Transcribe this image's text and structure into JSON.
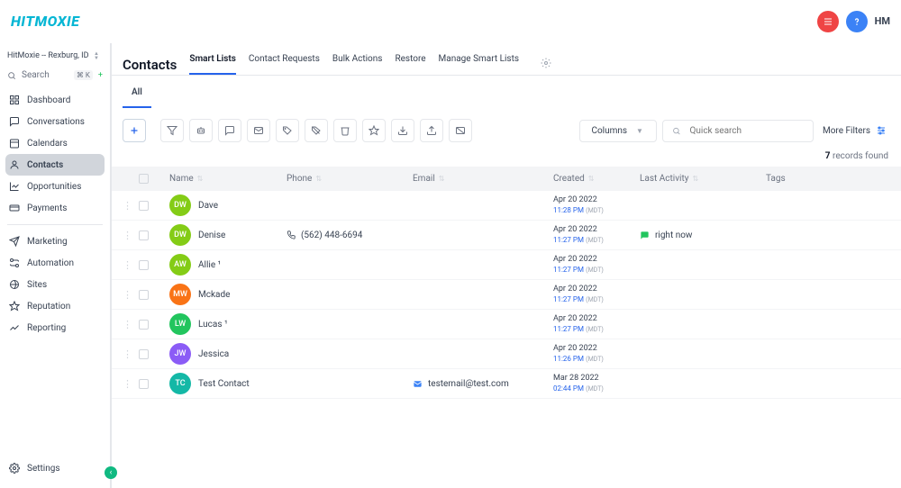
{
  "topbar": {
    "logo": "HITMOXIE",
    "hm": "HM"
  },
  "account": {
    "name": "HitMoxie -- Rexburg, ID"
  },
  "search": {
    "placeholder": "Search",
    "kbd": "⌘ K"
  },
  "nav": {
    "dashboard": "Dashboard",
    "conversations": "Conversations",
    "calendars": "Calendars",
    "contacts": "Contacts",
    "opportunities": "Opportunities",
    "payments": "Payments",
    "marketing": "Marketing",
    "automation": "Automation",
    "sites": "Sites",
    "reputation": "Reputation",
    "reporting": "Reporting",
    "settings": "Settings"
  },
  "page": {
    "title": "Contacts"
  },
  "tabs": {
    "smartlists": "Smart Lists",
    "requests": "Contact Requests",
    "bulk": "Bulk Actions",
    "restore": "Restore",
    "manage": "Manage Smart Lists"
  },
  "subtabs": {
    "all": "All"
  },
  "toolbar": {
    "columns": "Columns",
    "quicksearch_placeholder": "Quick search",
    "morefilters": "More Filters"
  },
  "records": {
    "count": "7",
    "label": " records found"
  },
  "cols": {
    "name": "Name",
    "phone": "Phone",
    "email": "Email",
    "created": "Created",
    "activity": "Last Activity",
    "tags": "Tags"
  },
  "rows": [
    {
      "initials": "DW",
      "color": "#84cc16",
      "name": "Dave",
      "phone": "",
      "email": "",
      "created_date": "Apr 20 2022",
      "created_time": "11:28 PM",
      "created_tz": "(MDT)",
      "activity": ""
    },
    {
      "initials": "DW",
      "color": "#84cc16",
      "name": "Denise",
      "phone": "(562) 448-6694",
      "email": "",
      "created_date": "Apr 20 2022",
      "created_time": "11:27 PM",
      "created_tz": "(MDT)",
      "activity": "right now"
    },
    {
      "initials": "AW",
      "color": "#84cc16",
      "name": "Allie ¹",
      "phone": "",
      "email": "",
      "created_date": "Apr 20 2022",
      "created_time": "11:27 PM",
      "created_tz": "(MDT)",
      "activity": ""
    },
    {
      "initials": "MW",
      "color": "#f97316",
      "name": "Mckade",
      "phone": "",
      "email": "",
      "created_date": "Apr 20 2022",
      "created_time": "11:27 PM",
      "created_tz": "(MDT)",
      "activity": ""
    },
    {
      "initials": "LW",
      "color": "#22c55e",
      "name": "Lucas ¹",
      "phone": "",
      "email": "",
      "created_date": "Apr 20 2022",
      "created_time": "11:27 PM",
      "created_tz": "(MDT)",
      "activity": ""
    },
    {
      "initials": "JW",
      "color": "#8b5cf6",
      "name": "Jessica",
      "phone": "",
      "email": "",
      "created_date": "Apr 20 2022",
      "created_time": "11:26 PM",
      "created_tz": "(MDT)",
      "activity": ""
    },
    {
      "initials": "TC",
      "color": "#14b8a6",
      "name": "Test Contact",
      "phone": "",
      "email": "testemail@test.com",
      "created_date": "Mar 28 2022",
      "created_time": "02:44 PM",
      "created_tz": "(MDT)",
      "activity": ""
    }
  ]
}
